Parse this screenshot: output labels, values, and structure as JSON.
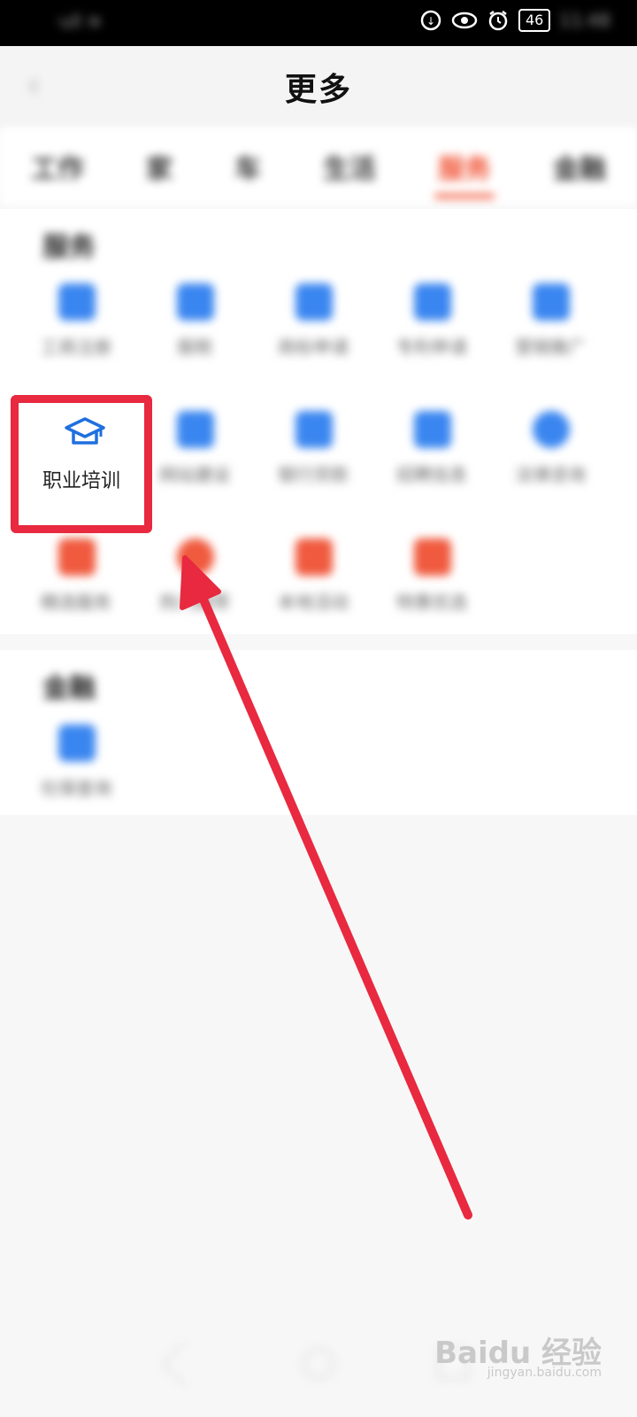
{
  "status_bar": {
    "carrier": "‧ull ≋",
    "battery": "46",
    "time": "11:48"
  },
  "header": {
    "title": "更多"
  },
  "tabs": [
    {
      "label": "工作"
    },
    {
      "label": "家"
    },
    {
      "label": "车"
    },
    {
      "label": "生活"
    },
    {
      "label": "服务"
    },
    {
      "label": "金融"
    }
  ],
  "service_section": {
    "title": "服务",
    "items": [
      {
        "label": "工商注册",
        "color": "#3a86f0"
      },
      {
        "label": "报税",
        "color": "#3a86f0"
      },
      {
        "label": "商标申请",
        "color": "#3a86f0"
      },
      {
        "label": "专利申请",
        "color": "#3a86f0"
      },
      {
        "label": "营销推广",
        "color": "#3a86f0"
      },
      {
        "label": "职业培训",
        "color": "#1f6fe0"
      },
      {
        "label": "网站建设",
        "color": "#3a86f0"
      },
      {
        "label": "银行贷款",
        "color": "#3a86f0"
      },
      {
        "label": "招聘信息",
        "color": "#3a86f0"
      },
      {
        "label": "法律咨询",
        "color": "#3a86f0"
      },
      {
        "label": "精选服务",
        "color": "#f05a3e"
      },
      {
        "label": "热门推荐",
        "color": "#f05a3e"
      },
      {
        "label": "本地活动",
        "color": "#f05a3e"
      },
      {
        "label": "特惠优选",
        "color": "#f05a3e"
      }
    ]
  },
  "finance_section": {
    "title": "金融",
    "items": [
      {
        "label": "社保查询",
        "color": "#3a86f0"
      }
    ]
  },
  "highlight": {
    "label": "职业培训",
    "icon": "graduation-cap-icon",
    "box_color": "#e8293f"
  },
  "annotation": {
    "arrow_color": "#e8293f"
  },
  "watermark": {
    "brand": "Baidu 经验",
    "url": "jingyan.baidu.com"
  }
}
